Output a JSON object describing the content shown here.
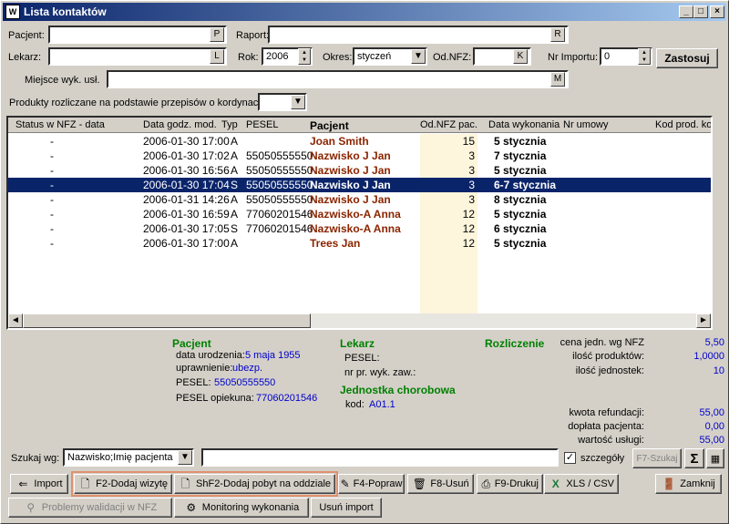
{
  "window": {
    "title": "Lista kontaktów"
  },
  "filters": {
    "pacjent_label": "Pacjent:",
    "pacjent_btn": "P",
    "raport_label": "Raport:",
    "raport_btn": "R",
    "lekarz_label": "Lekarz:",
    "lekarz_btn": "L",
    "rok_label": "Rok:",
    "rok_value": "2006",
    "okres_label": "Okres:",
    "okres_value": "styczeń",
    "odnfz_label": "Od.NFZ:",
    "odnfz_btn": "K",
    "nrimportu_label": "Nr Importu:",
    "nrimportu_value": "0",
    "zastosuj": "Zastosuj",
    "miejsce_label": "Miejsce wyk. usł.",
    "miejsce_btn": "M",
    "produkty_label": "Produkty rozliczane na podstawie przepisów o kordynacji:"
  },
  "table": {
    "columns": [
      "Status w NFZ - data",
      "Data godz. mod.",
      "Typ",
      "PESEL",
      "Pacjent",
      "Od.NFZ pac.",
      "Data wykonania",
      "Nr umowy",
      "Kod prod. ko"
    ],
    "rows": [
      {
        "status": "-",
        "data": "2006-01-30 17:00",
        "typ": "A",
        "pesel": "",
        "pacjent": "Joan Smith",
        "odnfz": "15",
        "wykonania": "5 stycznia"
      },
      {
        "status": "-",
        "data": "2006-01-30 17:02",
        "typ": "A",
        "pesel": "55050555550",
        "pacjent": "Nazwisko J Jan",
        "odnfz": "3",
        "wykonania": "7 stycznia"
      },
      {
        "status": "-",
        "data": "2006-01-30 16:56",
        "typ": "A",
        "pesel": "55050555550",
        "pacjent": "Nazwisko J Jan",
        "odnfz": "3",
        "wykonania": "5 stycznia"
      },
      {
        "status": "-",
        "data": "2006-01-30 17:04",
        "typ": "S",
        "pesel": "55050555550",
        "pacjent": "Nazwisko J Jan",
        "odnfz": "3",
        "wykonania": "6-7 stycznia"
      },
      {
        "status": "-",
        "data": "2006-01-31 14:26",
        "typ": "A",
        "pesel": "55050555550",
        "pacjent": "Nazwisko J Jan",
        "odnfz": "3",
        "wykonania": "8 stycznia"
      },
      {
        "status": "-",
        "data": "2006-01-30 16:59",
        "typ": "A",
        "pesel": "77060201546",
        "pacjent": "Nazwisko-A Anna",
        "odnfz": "12",
        "wykonania": "5 stycznia"
      },
      {
        "status": "-",
        "data": "2006-01-30 17:05",
        "typ": "S",
        "pesel": "77060201546",
        "pacjent": "Nazwisko-A Anna",
        "odnfz": "12",
        "wykonania": "6 stycznia"
      },
      {
        "status": "-",
        "data": "2006-01-30 17:00",
        "typ": "A",
        "pesel": "",
        "pacjent": "Trees Jan",
        "odnfz": "12",
        "wykonania": "5 stycznia"
      }
    ]
  },
  "details": {
    "pacjent": {
      "header": "Pacjent",
      "data_ur_label": "data urodzenia:",
      "data_ur": "5 maja 1955",
      "uprawnienie_label": "uprawnienie:",
      "uprawnienie": "ubezp.",
      "pesel_label": "PESEL:",
      "pesel": "55050555550",
      "pesel_op_label": "PESEL opiekuna:",
      "pesel_op": "77060201546"
    },
    "lekarz": {
      "header": "Lekarz",
      "pesel_label": "PESEL:",
      "nr_label": "nr pr. wyk. zaw.:"
    },
    "jednostka": {
      "header": "Jednostka chorobowa",
      "kod_label": "kod:",
      "kod": "A01.1"
    },
    "rozliczenie": {
      "header": "Rozliczenie",
      "cena_label": "cena jedn. wg NFZ",
      "cena": "5,50",
      "ilosc_prod_label": "ilość produktów:",
      "ilosc_prod": "1,0000",
      "ilosc_jedn_label": "ilość jednostek:",
      "ilosc_jedn": "10",
      "kwota_label": "kwota refundacji:",
      "kwota": "55,00",
      "doplata_label": "dopłata pacjenta:",
      "doplata": "0,00",
      "wartosc_label": "wartość usługi:",
      "wartosc": "55,00"
    }
  },
  "search": {
    "label": "Szukaj wg:",
    "mode": "Nazwisko;Imię pacjenta",
    "szczegoly": "szczegóły",
    "f7": "F7-Szukaj",
    "sigma": "Σ"
  },
  "toolbar": {
    "import": "Import",
    "f2": "F2-Dodaj wizytę",
    "shf2": "ShF2-Dodaj pobyt na oddziale",
    "f4": "F4-Popraw",
    "f8": "F8-Usuń",
    "f9": "F9-Drukuj",
    "xls": "XLS / CSV",
    "zamknij": "Zamknij",
    "problemy": "Problemy walidacji w NFZ",
    "monitoring": "Monitoring wykonania",
    "usun_import": "Usuń import"
  }
}
